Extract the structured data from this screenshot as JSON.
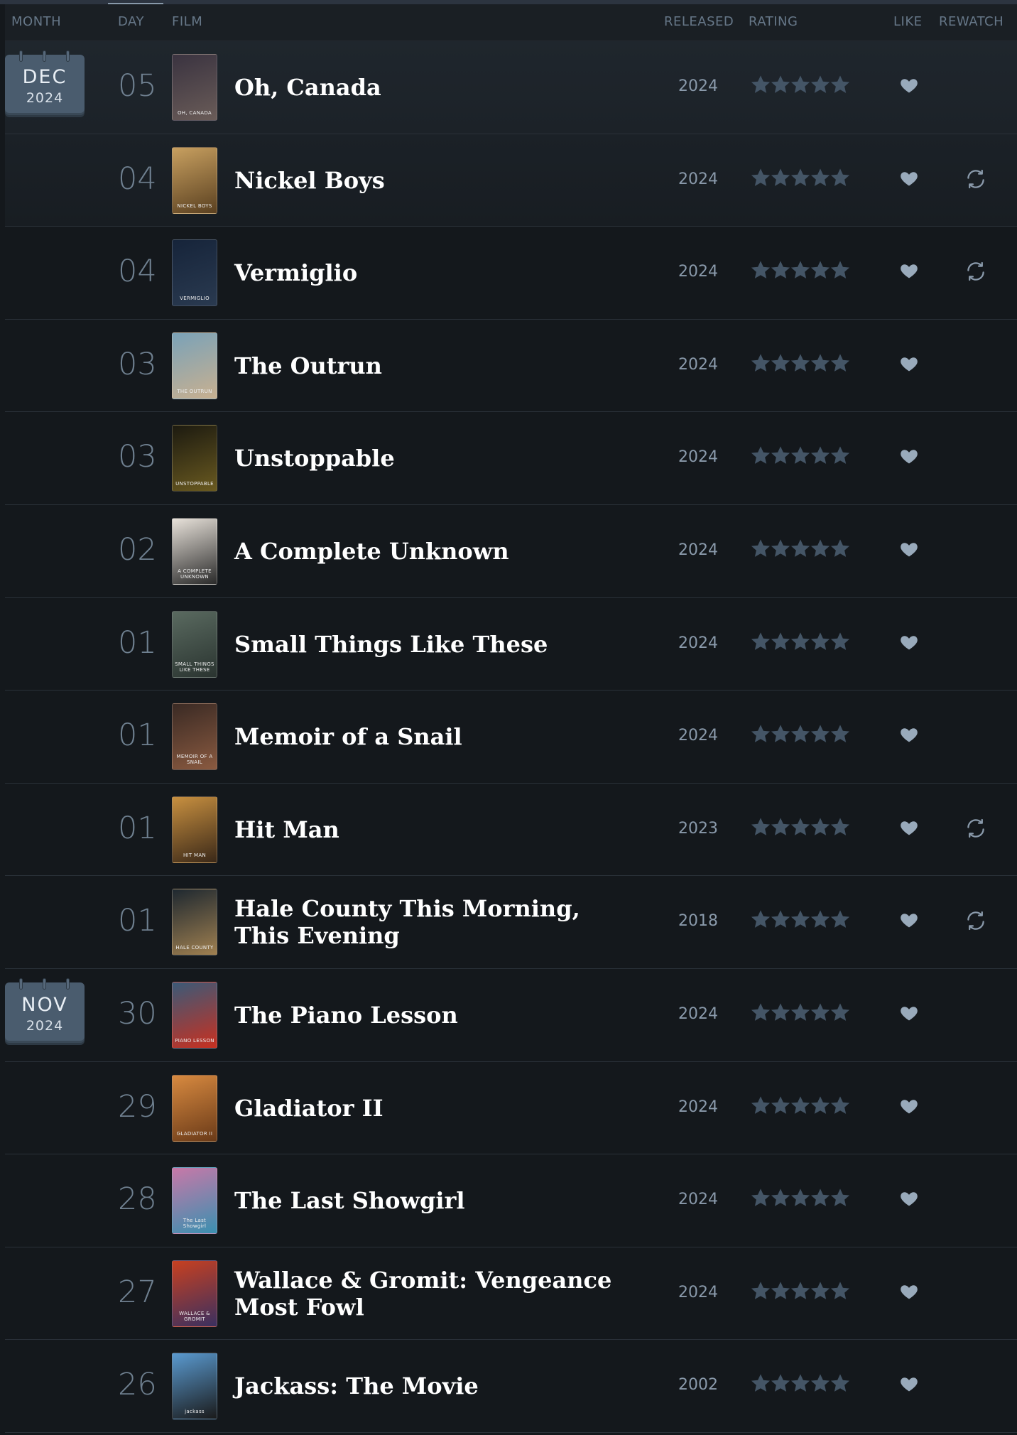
{
  "header": {
    "month": "MONTH",
    "day": "DAY",
    "film": "FILM",
    "released": "RELEASED",
    "rating": "RATING",
    "like": "LIKE",
    "rewatch": "REWATCH"
  },
  "colors": {
    "background": "#14181c",
    "calendar": "#4a5c6e",
    "star": "#445566",
    "heart": "#99aabb"
  },
  "entries": [
    {
      "month": "DEC",
      "year": "2024",
      "day": "05",
      "title": "Oh, Canada",
      "poster_text": "OH, CANADA",
      "released": "2024",
      "rating_stars": 5,
      "liked": true,
      "rewatch": false,
      "poster": [
        "#3a3340",
        "#6a5c58"
      ]
    },
    {
      "day": "04",
      "title": "Nickel Boys",
      "poster_text": "NICKEL BOYS",
      "released": "2024",
      "rating_stars": 5,
      "liked": true,
      "rewatch": true,
      "poster": [
        "#c8a060",
        "#5a4020"
      ]
    },
    {
      "day": "04",
      "title": "Vermiglio",
      "poster_text": "VERMIGLIO",
      "released": "2024",
      "rating_stars": 5,
      "liked": true,
      "rewatch": true,
      "poster": [
        "#16243a",
        "#2a3a50"
      ]
    },
    {
      "day": "03",
      "title": "The Outrun",
      "poster_text": "THE OUTRUN",
      "released": "2024",
      "rating_stars": 5,
      "liked": true,
      "rewatch": false,
      "poster": [
        "#7aa2b8",
        "#c8b090"
      ]
    },
    {
      "day": "03",
      "title": "Unstoppable",
      "poster_text": "UNSTOPPABLE",
      "released": "2024",
      "rating_stars": 5,
      "liked": true,
      "rewatch": false,
      "poster": [
        "#1c1a10",
        "#6a5a20"
      ]
    },
    {
      "day": "02",
      "title": "A Complete Unknown",
      "poster_text": "A COMPLETE UNKNOWN",
      "released": "2024",
      "rating_stars": 5,
      "liked": true,
      "rewatch": false,
      "poster": [
        "#e8e2da",
        "#2a2a2a"
      ]
    },
    {
      "day": "01",
      "title": "Small Things Like These",
      "poster_text": "SMALL THINGS LIKE THESE",
      "released": "2024",
      "rating_stars": 5,
      "liked": true,
      "rewatch": false,
      "poster": [
        "#5a6a60",
        "#2a3430"
      ]
    },
    {
      "day": "01",
      "title": "Memoir of a Snail",
      "poster_text": "MEMOIR OF A SNAIL",
      "released": "2024",
      "rating_stars": 5,
      "liked": true,
      "rewatch": false,
      "poster": [
        "#3a2a24",
        "#8a5a40"
      ]
    },
    {
      "day": "01",
      "title": "Hit Man",
      "poster_text": "HIT MAN",
      "released": "2023",
      "rating_stars": 5,
      "liked": true,
      "rewatch": true,
      "poster": [
        "#c89040",
        "#3a2818"
      ]
    },
    {
      "day": "01",
      "title": "Hale County This Morning, This Evening",
      "poster_text": "HALE COUNTY",
      "released": "2018",
      "rating_stars": 5,
      "liked": true,
      "rewatch": true,
      "poster": [
        "#1e2830",
        "#a08050"
      ]
    },
    {
      "month": "NOV",
      "year": "2024",
      "day": "30",
      "title": "The Piano Lesson",
      "poster_text": "PIANO LESSON",
      "released": "2024",
      "rating_stars": 5,
      "liked": true,
      "rewatch": false,
      "poster": [
        "#3a5a78",
        "#c83020"
      ]
    },
    {
      "day": "29",
      "title": "Gladiator II",
      "poster_text": "GLADIATOR II",
      "released": "2024",
      "rating_stars": 5,
      "liked": true,
      "rewatch": false,
      "poster": [
        "#d88a40",
        "#6a3a18"
      ]
    },
    {
      "day": "28",
      "title": "The Last Showgirl",
      "poster_text": "The Last Showgirl",
      "released": "2024",
      "rating_stars": 5,
      "liked": true,
      "rewatch": false,
      "poster": [
        "#c878a8",
        "#3a90b0"
      ]
    },
    {
      "day": "27",
      "title": "Wallace & Gromit: Vengeance Most Fowl",
      "poster_text": "WALLACE & GROMIT",
      "released": "2024",
      "rating_stars": 5,
      "liked": true,
      "rewatch": false,
      "poster": [
        "#c84020",
        "#3a3060"
      ]
    },
    {
      "day": "26",
      "title": "Jackass: The Movie",
      "poster_text": "jackass",
      "released": "2002",
      "rating_stars": 5,
      "liked": true,
      "rewatch": false,
      "poster": [
        "#5a9ad0",
        "#1a1a1a"
      ]
    }
  ]
}
